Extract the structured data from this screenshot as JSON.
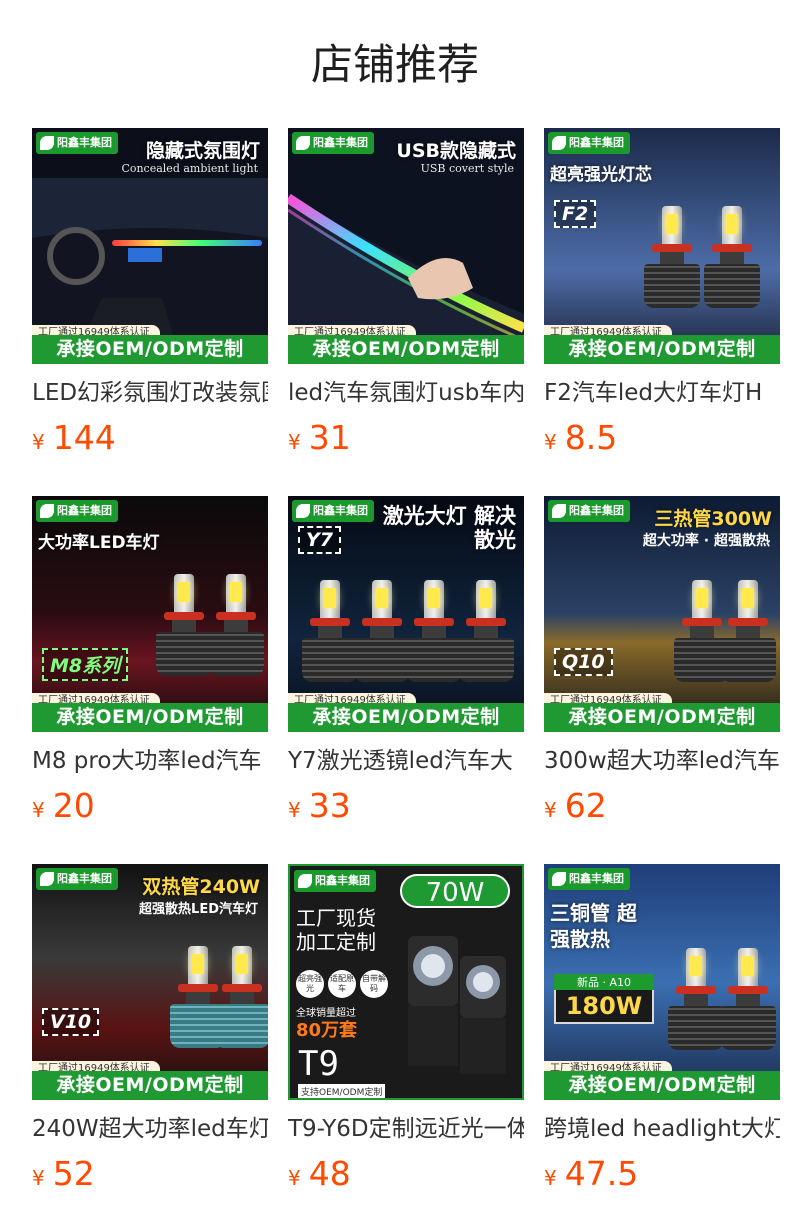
{
  "page": {
    "title": "店铺推荐"
  },
  "colors": {
    "price": "#ff4a00",
    "oem_banner": "#1f9a32",
    "brand_badge": "#1a9a2c"
  },
  "common": {
    "brand": "阳鑫丰集团",
    "cert": "工厂通过16949体系认证",
    "oem": "承接OEM/ODM定制",
    "currency": "¥"
  },
  "products": [
    {
      "name": "LED幻彩氛围灯改装氛围灯",
      "price": "144",
      "headline": "隐藏式氛围灯",
      "subline": "Concealed ambient light"
    },
    {
      "name": "led汽车氛围灯usb车内",
      "price": "31",
      "headline": "USB款隐藏式",
      "subline": "USB covert style"
    },
    {
      "name": "F2汽车led大灯车灯H",
      "price": "8.5",
      "headline": "超亮强光灯芯",
      "tag": "F2"
    },
    {
      "name": "M8 pro大功率led汽车",
      "price": "20",
      "headline": "大功率LED车灯",
      "tag": "M8系列"
    },
    {
      "name": "Y7激光透镜led汽车大",
      "price": "33",
      "headline": "激光大灯 解决散光",
      "tag": "Y7"
    },
    {
      "name": "300w超大功率led汽车",
      "price": "62",
      "headline": "三热管300W",
      "subline": "超大功率 · 超强散热",
      "tag": "Q10"
    },
    {
      "name": "240W超大功率led车灯",
      "price": "52",
      "headline": "双热管240W",
      "subline": "超强散热LED汽车灯",
      "tag": "V10"
    },
    {
      "name": "T9-Y6D定制远近光一体",
      "price": "48",
      "headline": "工厂现货 加工定制",
      "tag": "T9",
      "badge": "70W",
      "sales_label": "全球销量超过",
      "sales_value": "80万套",
      "footer": "支持OEM/ODM定制",
      "features": [
        "超亮强光",
        "适配原车",
        "自带解码"
      ]
    },
    {
      "name": "跨境led headlight大灯",
      "price": "47.5",
      "headline": "三铜管 超强散热",
      "tag": "新品 · A10",
      "watt": "180W"
    }
  ]
}
